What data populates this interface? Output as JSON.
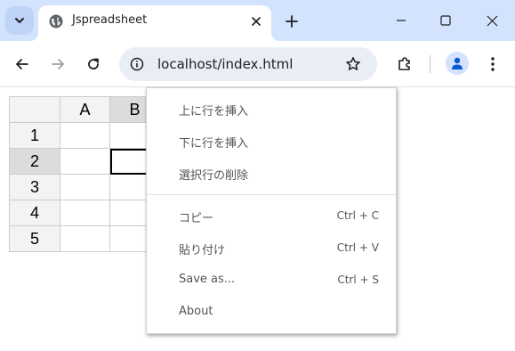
{
  "browser": {
    "tab_title": "Jspreadsheet",
    "url": "localhost/index.html"
  },
  "sheet": {
    "columns": [
      "A",
      "B"
    ],
    "rows": [
      "1",
      "2",
      "3",
      "4",
      "5"
    ],
    "selected_column": "B",
    "selected_row": "2"
  },
  "context_menu": {
    "items": [
      {
        "label": "上に行を挿入",
        "shortcut": ""
      },
      {
        "label": "下に行を挿入",
        "shortcut": ""
      },
      {
        "label": "選択行の削除",
        "shortcut": ""
      },
      {
        "label": "コピー",
        "shortcut": "Ctrl + C"
      },
      {
        "label": "貼り付け",
        "shortcut": "Ctrl + V"
      },
      {
        "label": "Save as...",
        "shortcut": "Ctrl + S"
      },
      {
        "label": "About",
        "shortcut": ""
      }
    ]
  },
  "colors": {
    "frame": "#d3e3fd",
    "omnibox": "#e9eef6",
    "header_bg": "#f3f3f3",
    "header_selected": "#dcdcdc",
    "menu_text": "#555555"
  }
}
